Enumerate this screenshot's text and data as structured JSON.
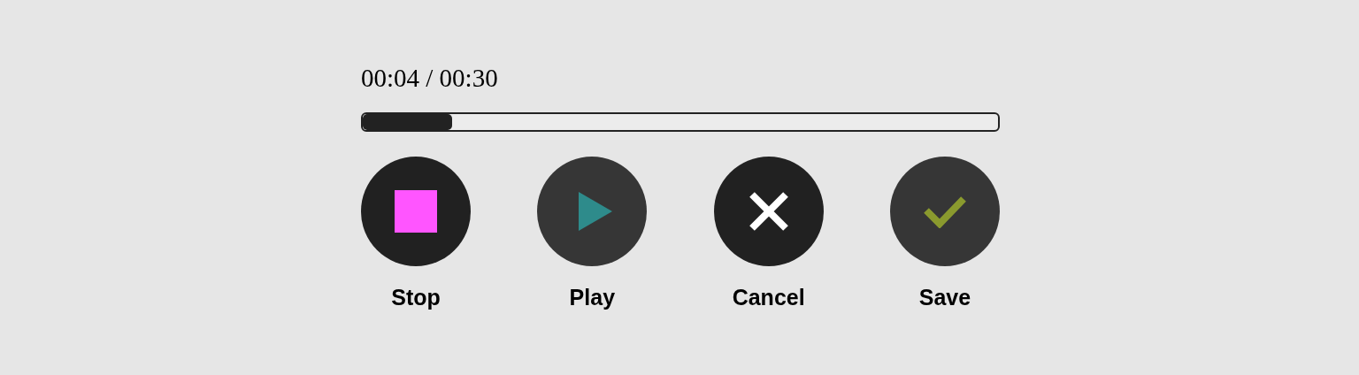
{
  "player": {
    "time": "00:04 / 00:30",
    "progress": {
      "level": 0.14
    }
  },
  "buttons": [
    {
      "kind": "stop",
      "label": "Stop",
      "disabled": false,
      "color": "#ff55ff"
    },
    {
      "kind": "play",
      "label": "Play",
      "disabled": true,
      "color": "#2e8b8b"
    },
    {
      "kind": "cancel",
      "label": "Cancel",
      "disabled": false,
      "color": "#ffffff"
    },
    {
      "kind": "save",
      "label": "Save",
      "disabled": true,
      "color": "#8a9a2e"
    }
  ]
}
